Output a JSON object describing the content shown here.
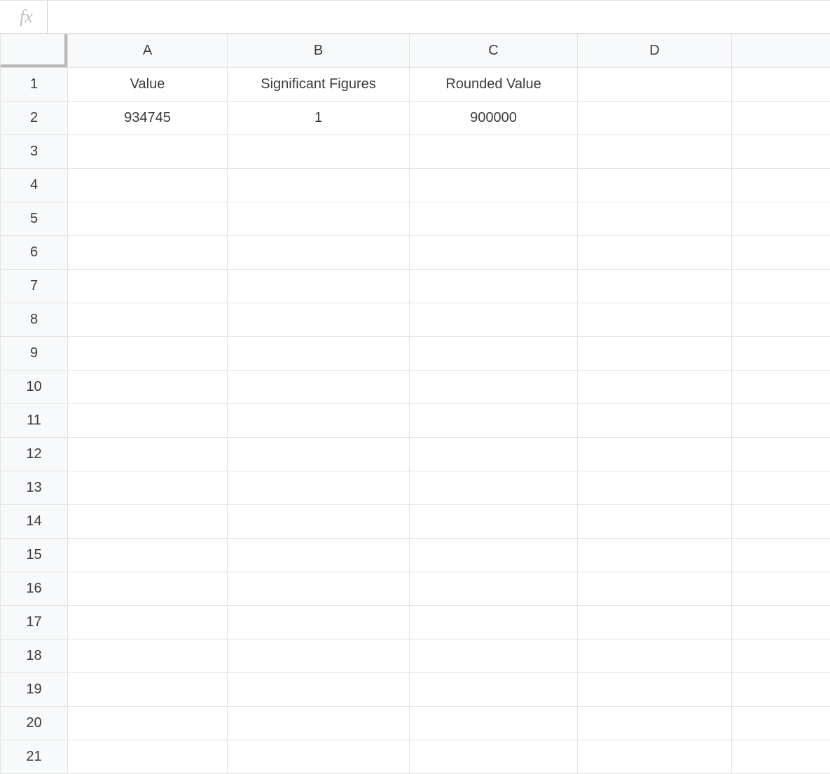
{
  "formula_bar": {
    "fx_label": "fx",
    "value": ""
  },
  "columns": [
    "A",
    "B",
    "C",
    "D"
  ],
  "row_count": 21,
  "headers": {
    "A": "Value",
    "B": "Significant Figures",
    "C": "Rounded Value"
  },
  "data_row": {
    "A": "934745",
    "B": "1",
    "C": "900000"
  }
}
